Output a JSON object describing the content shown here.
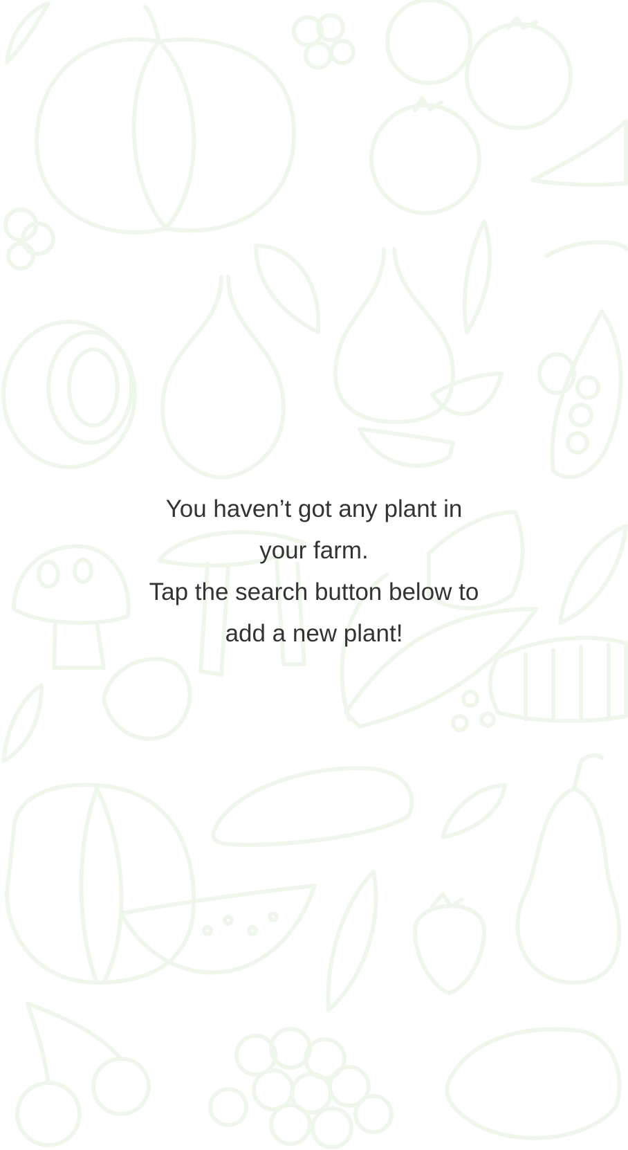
{
  "empty_state": {
    "line1": "You haven’t got any plant in",
    "line2": "your farm.",
    "line3": "Tap the search button below to",
    "line4": "add a new plant!"
  },
  "background": {
    "icon": "vegetable-doodle-pattern",
    "stroke_color": "#e6f4e3"
  },
  "colors": {
    "text": "#333333",
    "background": "#ffffff"
  }
}
